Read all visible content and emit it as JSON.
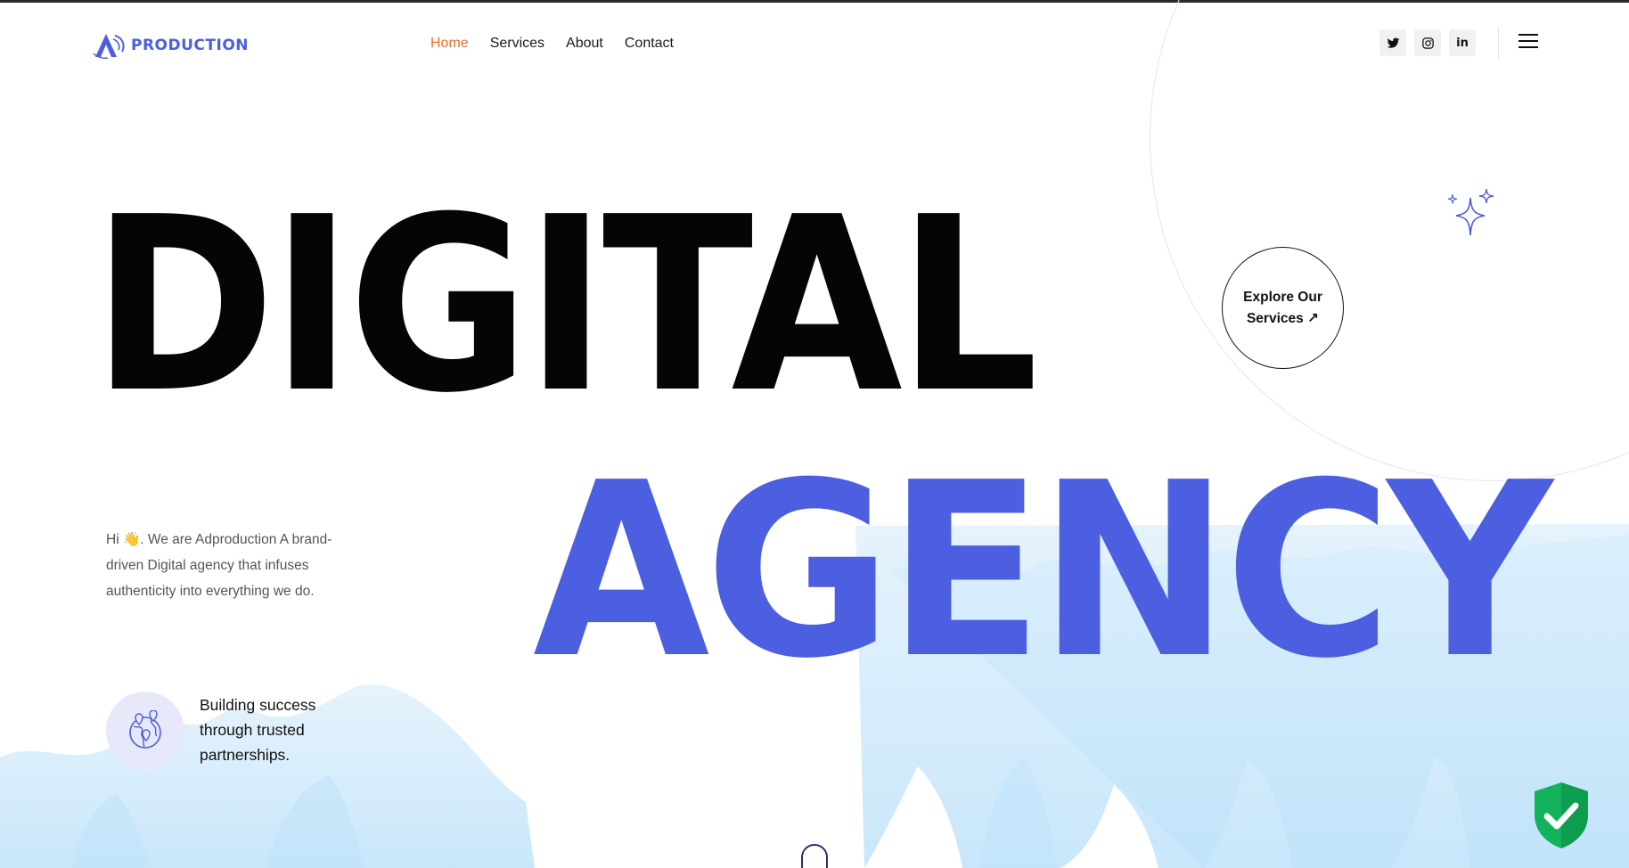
{
  "header": {
    "logo_text": "PRODUCTION",
    "nav": [
      {
        "label": "Home",
        "active": true
      },
      {
        "label": "Services",
        "active": false
      },
      {
        "label": "About",
        "active": false
      },
      {
        "label": "Contact",
        "active": false
      }
    ],
    "socials": [
      "twitter-icon",
      "instagram-icon",
      "linkedin-icon"
    ],
    "linkedin_glyph": "in"
  },
  "hero": {
    "headline_line1": "DIGITAL",
    "headline_line2": "AGENCY",
    "explore_button": "Explore Our Services ↗",
    "intro": "Hi 👋. We are Adproduction A brand-driven Digital agency that infuses authenticity into everything we do.",
    "feature_text": "Building success through trusted partnerships."
  },
  "colors": {
    "accent_blue": "#4b5fe0",
    "nav_active": "#e8702a",
    "headline_black": "#050505",
    "badge_green": "#12b35a",
    "watercolor": "#cfe9fb"
  }
}
